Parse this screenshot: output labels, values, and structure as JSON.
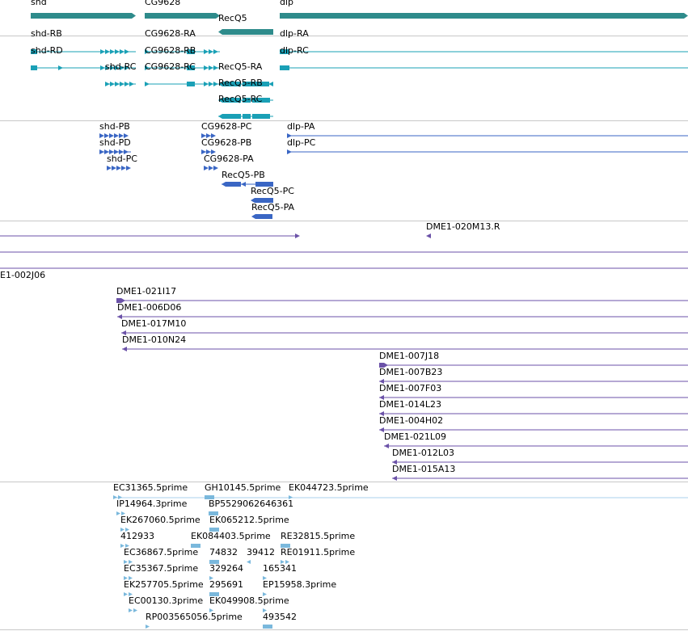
{
  "colors": {
    "gene": "#2e8b8b",
    "transcript": "#1aa0b6",
    "protein": "#3a66c4",
    "clone": "#6b52a8",
    "est": "#7ab8dc",
    "est_line": "#a8d0ec",
    "separator": "#c8c8c8"
  },
  "tracks": {
    "genes": [
      "shd",
      "CG9628",
      "RecQ5",
      "dlp"
    ],
    "transcripts": [
      "shd-RB",
      "CG9628-RA",
      "dlp-RA",
      "shd-RD",
      "CG9628-RB",
      "dlp-RC",
      "shd-RC",
      "CG9628-RC",
      "RecQ5-RA",
      "RecQ5-RB",
      "RecQ5-RC"
    ],
    "proteins": [
      "shd-PB",
      "CG9628-PC",
      "dlp-PA",
      "shd-PD",
      "CG9628-PB",
      "dlp-PC",
      "shd-PC",
      "CG9628-PA",
      "RecQ5-PB",
      "RecQ5-PC",
      "RecQ5-PA"
    ],
    "clones": [
      "DME1-020M13.R",
      "E1-002J06",
      "DME1-021I17",
      "DME1-006D06",
      "DME1-017M10",
      "DME1-010N24",
      "DME1-007J18",
      "DME1-007B23",
      "DME1-007F03",
      "DME1-014L23",
      "DME1-004H02",
      "DME1-021L09",
      "DME1-012L03",
      "DME1-015A13"
    ],
    "ests": [
      "EC31365.5prime",
      "GH10145.5prime",
      "EK044723.5prime",
      "IP14964.3prime",
      "BP5529062646361",
      "EK267060.5prime",
      "EK065212.5prime",
      "412933",
      "EK084403.5prime",
      "RE32815.5prime",
      "EC36867.5prime",
      "74832",
      "39412",
      "RE01911.5prime",
      "EC35367.5prime",
      "329264",
      "165341",
      "EK257705.5prime",
      "295691",
      "EP15958.3prime",
      "EC00130.3prime",
      "EK049908.5prime",
      "RP003565056.5prime",
      "493542"
    ]
  }
}
